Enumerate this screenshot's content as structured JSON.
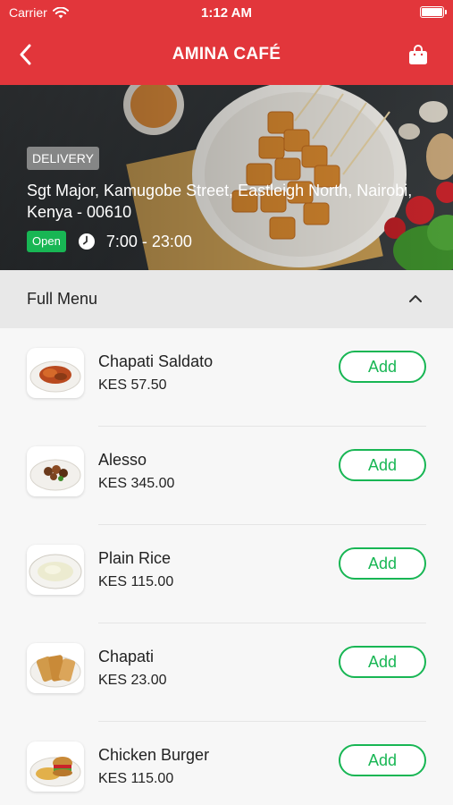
{
  "status_bar": {
    "carrier": "Carrier",
    "time": "1:12 AM"
  },
  "navbar": {
    "title": "AMINA CAFÉ",
    "back_icon": "chevron-left-icon",
    "cart_icon": "shopping-bag-icon"
  },
  "restaurant": {
    "delivery_label": "DELIVERY",
    "address": "Sgt Major, Kamugobe Street, Eastleigh North, Nairobi, Kenya - 00610",
    "status": "Open",
    "hours": "7:00 - 23:00"
  },
  "menu": {
    "title": "Full Menu",
    "items": [
      {
        "name": "Chapati Saldato",
        "price": "KES 57.50",
        "add_label": "Add"
      },
      {
        "name": "Alesso",
        "price": "KES 345.00",
        "add_label": "Add"
      },
      {
        "name": "Plain Rice",
        "price": "KES 115.00",
        "add_label": "Add"
      },
      {
        "name": "Chapati",
        "price": "KES 23.00",
        "add_label": "Add"
      },
      {
        "name": "Chicken Burger",
        "price": "KES 115.00",
        "add_label": "Add"
      }
    ]
  },
  "colors": {
    "brand_red": "#e2363b",
    "accent_green": "#18b654",
    "section_gray": "#e8e8e8"
  }
}
